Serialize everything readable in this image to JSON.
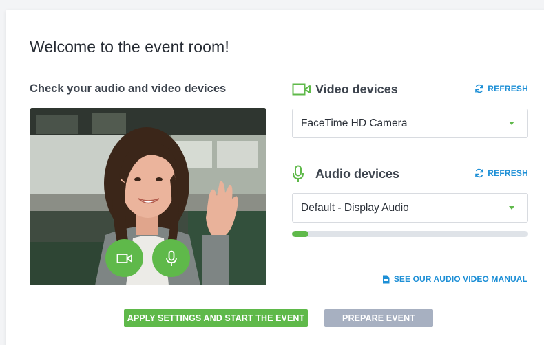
{
  "page": {
    "title": "Welcome to the event room!",
    "check_heading": "Check your audio and video devices"
  },
  "video_devices": {
    "title": "Video devices",
    "icon": "video-camera-icon",
    "refresh_label": "REFRESH",
    "selected": "FaceTime HD Camera"
  },
  "audio_devices": {
    "title": "Audio devices",
    "icon": "microphone-icon",
    "refresh_label": "REFRESH",
    "selected": "Default - Display Audio",
    "input_level_percent": 7
  },
  "preview": {
    "controls": [
      "camera-toggle",
      "microphone-toggle"
    ]
  },
  "links": {
    "manual": "SEE OUR AUDIO VIDEO MANUAL"
  },
  "actions": {
    "start": "APPLY SETTINGS AND START THE EVENT",
    "prepare": "PREPARE EVENT"
  },
  "colors": {
    "accent_green": "#5fb94a",
    "link_blue": "#1d8fd6",
    "secondary_button": "#a7b0c1"
  }
}
